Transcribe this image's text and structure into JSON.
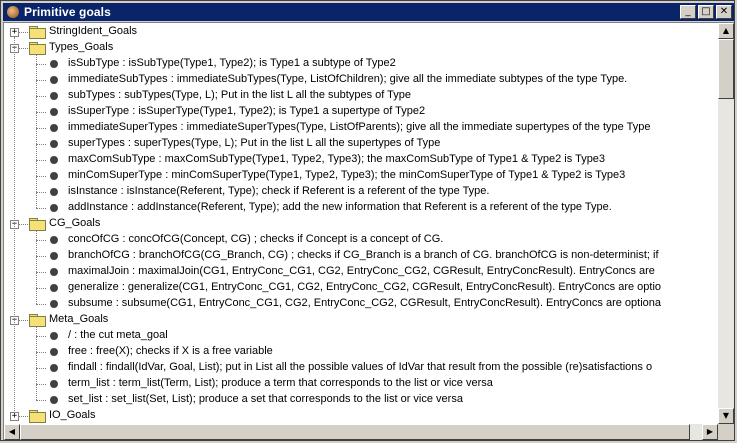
{
  "window": {
    "title": "Primitive goals"
  },
  "titlebar_buttons": {
    "minimize": "_",
    "maximize": "□",
    "close": "✕"
  },
  "tree": [
    {
      "type": "folder",
      "label": "StringIdent_Goals",
      "expander": "+"
    },
    {
      "type": "folder",
      "label": "Types_Goals",
      "expander": "−",
      "open": true
    },
    {
      "type": "leaf",
      "label": "isSubType : isSubType(Type1, Type2); is Type1 a subtype of Type2"
    },
    {
      "type": "leaf",
      "label": "immediateSubTypes : immediateSubTypes(Type, ListOfChildren); give all the immediate subtypes of the type Type."
    },
    {
      "type": "leaf",
      "label": "subTypes : subTypes(Type, L); Put in the list L all the subtypes of Type"
    },
    {
      "type": "leaf",
      "label": "isSuperType : isSuperType(Type1, Type2); is Type1 a supertype of Type2"
    },
    {
      "type": "leaf",
      "label": "immediateSuperTypes : immediateSuperTypes(Type, ListOfParents); give all the immediate supertypes of the type Type"
    },
    {
      "type": "leaf",
      "label": "superTypes : superTypes(Type, L); Put in the list L all the supertypes of Type"
    },
    {
      "type": "leaf",
      "label": "maxComSubType : maxComSubType(Type1, Type2, Type3); the maxComSubType of Type1 & Type2 is Type3"
    },
    {
      "type": "leaf",
      "label": "minComSuperType : minComSuperType(Type1, Type2, Type3); the minComSuperType of Type1 & Type2 is Type3"
    },
    {
      "type": "leaf",
      "label": "isInstance : isInstance(Referent, Type); check if Referent is a referent of the type Type."
    },
    {
      "type": "leaf",
      "label": "addInstance : addInstance(Referent, Type); add the new information that Referent is a referent of the type Type."
    },
    {
      "type": "folder",
      "label": "CG_Goals",
      "expander": "−",
      "open": true
    },
    {
      "type": "leaf",
      "label": "concOfCG : concOfCG(Concept, CG) ; checks if Concept is a concept of CG."
    },
    {
      "type": "leaf",
      "label": "branchOfCG : branchOfCG(CG_Branch, CG) ; checks if CG_Branch is a branch of CG. branchOfCG is non-determinist; if"
    },
    {
      "type": "leaf",
      "label": "maximalJoin : maximalJoin(CG1, EntryConc_CG1, CG2, EntryConc_CG2, CGResult, EntryConcResult). EntryConcs are"
    },
    {
      "type": "leaf",
      "label": "generalize : generalize(CG1, EntryConc_CG1, CG2, EntryConc_CG2, CGResult, EntryConcResult). EntryConcs are optio"
    },
    {
      "type": "leaf",
      "label": "subsume : subsume(CG1, EntryConc_CG1, CG2, EntryConc_CG2, CGResult, EntryConcResult). EntryConcs are optiona"
    },
    {
      "type": "folder",
      "label": "Meta_Goals",
      "expander": "−",
      "open": true
    },
    {
      "type": "leaf",
      "label": "/ : the cut meta_goal"
    },
    {
      "type": "leaf",
      "label": "free : free(X); checks if X is a free variable"
    },
    {
      "type": "leaf",
      "label": "findall : findall(IdVar, Goal, List); put in List all the possible values of IdVar that result from the possible (re)satisfactions o"
    },
    {
      "type": "leaf",
      "label": "term_list : term_list(Term, List); produce a term that corresponds to the list or vice versa"
    },
    {
      "type": "leaf",
      "label": "set_list : set_list(Set, List); produce a set that corresponds to the list or vice versa"
    },
    {
      "type": "folder",
      "label": "IO_Goals",
      "expander": "+"
    }
  ],
  "scrollbars": {
    "up": "▲",
    "down": "▼",
    "left": "◀",
    "right": "▶"
  },
  "colors": {
    "title_bg": "#0a246a",
    "folder": "#f8e078",
    "face": "#d4d0c8"
  }
}
